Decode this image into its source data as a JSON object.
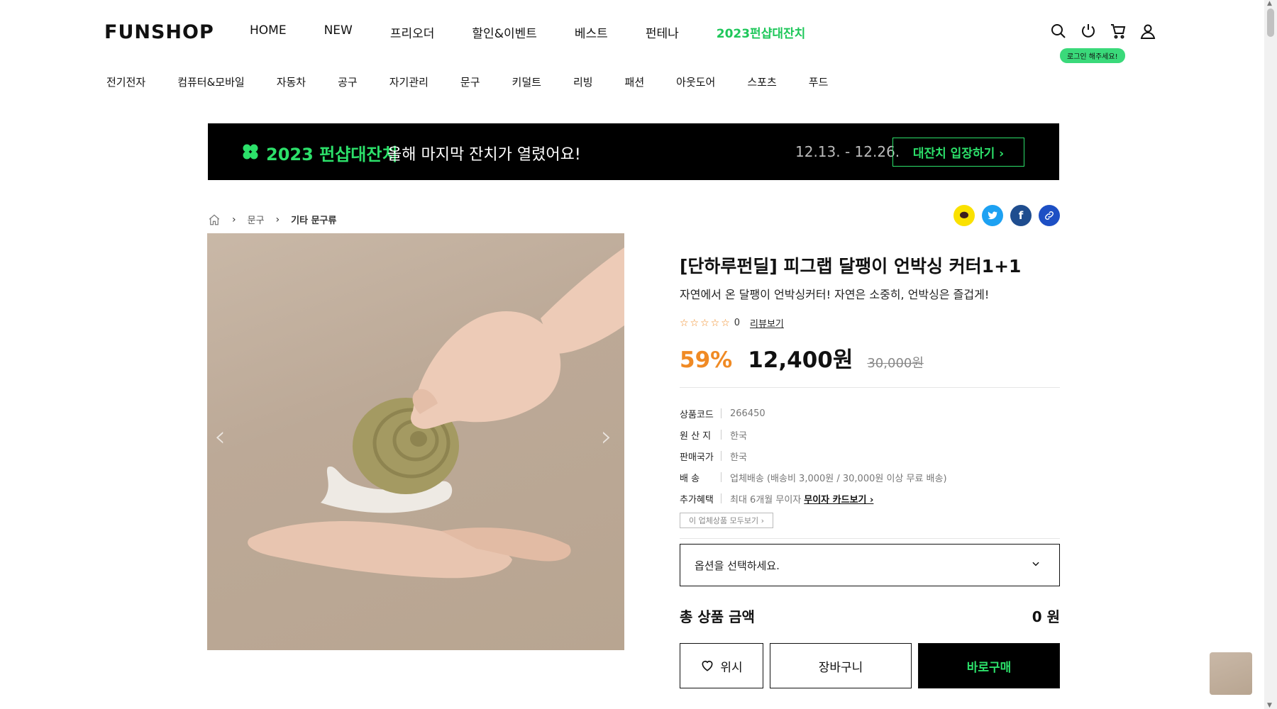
{
  "brand": {
    "logo": "FUNSHOP",
    "accent": "#2ce06a",
    "discount_color": "#f08a24"
  },
  "gnb": [
    {
      "label": "HOME"
    },
    {
      "label": "NEW"
    },
    {
      "label": "프리오더"
    },
    {
      "label": "할인&이벤트"
    },
    {
      "label": "베스트"
    },
    {
      "label": "펀테나"
    },
    {
      "label": "2023펀샵대잔치"
    }
  ],
  "header_icons": [
    "search-icon",
    "power-icon",
    "cart-icon",
    "user-icon"
  ],
  "login_badge": "로그인 해주세요!",
  "categories": [
    {
      "label": "전기전자"
    },
    {
      "label": "컴퓨터&모바일"
    },
    {
      "label": "자동차"
    },
    {
      "label": "공구"
    },
    {
      "label": "자기관리"
    },
    {
      "label": "문구"
    },
    {
      "label": "키덜트"
    },
    {
      "label": "리빙"
    },
    {
      "label": "패션"
    },
    {
      "label": "아웃도어"
    },
    {
      "label": "스포츠"
    },
    {
      "label": "푸드"
    }
  ],
  "banner": {
    "title": "2023 펀샵대잔치",
    "subtitle": "올해 마지막 잔치가 열렸어요!",
    "date": "12.13. - 12.26.",
    "button": "대잔치 입장하기 ›"
  },
  "breadcrumb": {
    "level1": "문구",
    "level2": "기타 문구류"
  },
  "share": [
    "kakaotalk-icon",
    "twitter-icon",
    "facebook-icon",
    "link-icon"
  ],
  "product": {
    "title": "[단하루펀딜] 피그랩 달팽이 언박싱 커터1+1",
    "description": "자연에서 온 달팽이 언박싱커터! 자연은 소중히, 언박싱은 즐겁게!",
    "rating": "☆☆☆☆☆",
    "review_count": "0",
    "review_link": "리뷰보기",
    "discount": "59%",
    "price": "12,400원",
    "original_price": "30,000원",
    "specs": [
      {
        "key": "상품코드",
        "value": "266450"
      },
      {
        "key": "원 산 지",
        "value": "한국"
      },
      {
        "key": "판매국가",
        "value": "한국"
      },
      {
        "key": "배 송",
        "value": "업체배송 (배송비 3,000원 / 30,000원 이상 무료 배송)"
      },
      {
        "key": "추가혜택",
        "value": "최대 6개월 무이자",
        "link": "무이자 카드보기 ›"
      }
    ],
    "all_products_button": "이 업체상품 모두보기 ›",
    "option_placeholder": "옵션을 선택하세요.",
    "total_label": "총 상품 금액",
    "total_value": "0 원",
    "wish_button": "위시",
    "cart_button": "장바구니",
    "buy_button": "바로구매"
  }
}
